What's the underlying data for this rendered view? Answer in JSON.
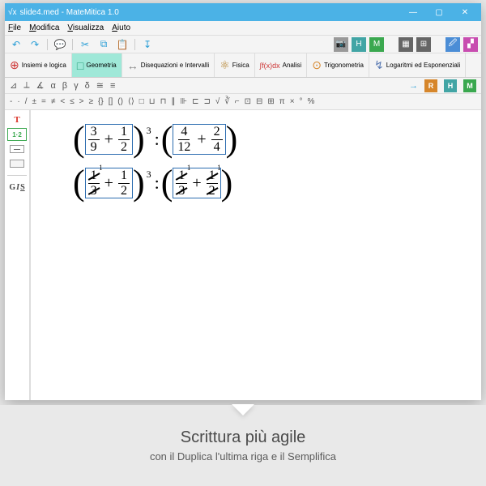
{
  "title": "slide4.med - MateMitica 1.0",
  "menu": {
    "file": "File",
    "modifica": "Modifica",
    "visualizza": "Visualizza",
    "aiuto": "Aiuto"
  },
  "toolbar_icons": {
    "undo": "↶",
    "redo": "↷",
    "speak": "💬",
    "cut": "✂",
    "copy": "⧉",
    "paste": "📋",
    "print": "↧"
  },
  "right_tiles": {
    "camera": "📷",
    "H": "H",
    "M": "M",
    "grid": "▦",
    "apps": "⊞",
    "pen": "🖉",
    "slash": "▞"
  },
  "categories": {
    "insiemi": "Insiemi\ne logica",
    "geometria": "Geometria",
    "disequazioni": "Disequazioni\ne Intervalli",
    "fisica": "Fisica",
    "analisi": "Analisi",
    "trigonometria": "Trigonometria",
    "logaritmi": "Logaritmi ed\nEsponenziali"
  },
  "cat_icons": {
    "insiemi": "⊕",
    "geometria": "□",
    "disequazioni": "↔",
    "fisica": "⚛",
    "analisi": "∫f(x)dx",
    "trigonometria": "⊙",
    "logaritmi": "↯"
  },
  "sym_row1": {
    "s1": "⊿",
    "s2": "⟂",
    "s3": "∡",
    "s4": "α",
    "s5": "β",
    "s6": "γ",
    "s7": "δ",
    "s8": "≅",
    "s9": "≡",
    "arrow": "→",
    "R": "R",
    "H": "H",
    "M": "M"
  },
  "sym_row2": {
    "a": "-",
    "b": "·",
    "c": "/",
    "d": "±",
    "e": "=",
    "f": "≠",
    "g": "<",
    "h": "≤",
    "i": ">",
    "j": "≥",
    "k": "{}",
    "l": "[]",
    "m": "()",
    "n": "⟨⟩",
    "o": "□",
    "p": "⊔",
    "q": "⊓",
    "r": "∥",
    "s": "⊪",
    "t": "⊏",
    "u": "⊐",
    "v": "√",
    "w": "∛",
    "x": "⌐",
    "y": "⊡",
    "z": "⊟",
    "aa": "⊞",
    "bb": "π",
    "cc": "×",
    "dd": "°",
    "ee": "%"
  },
  "sidebar": {
    "T": "T",
    "num": "1·2",
    "G": "G",
    "I": "I",
    "S": "S"
  },
  "equation": {
    "row1": {
      "g1_f1_n": "3",
      "g1_f1_d": "9",
      "plus": "+",
      "g1_f2_n": "1",
      "g1_f2_d": "2",
      "exp": "3",
      "g2_f1_n": "4",
      "g2_f1_d": "12",
      "g2_f2_n": "2",
      "g2_f2_d": "4"
    },
    "row2": {
      "g1_f1_n": "1",
      "g1_f1_n_small": "1",
      "g1_f1_d": "3",
      "plus": "+",
      "g1_f2_n": "1",
      "g1_f2_d": "2",
      "exp": "3",
      "g2_f1_n": "1",
      "g2_f1_d": "3",
      "g2_f2_n": "1",
      "g2_f2_d": "2"
    }
  },
  "caption": {
    "heading": "Scrittura più agile",
    "sub": "con il Duplica l'ultima riga e il Semplifica"
  }
}
